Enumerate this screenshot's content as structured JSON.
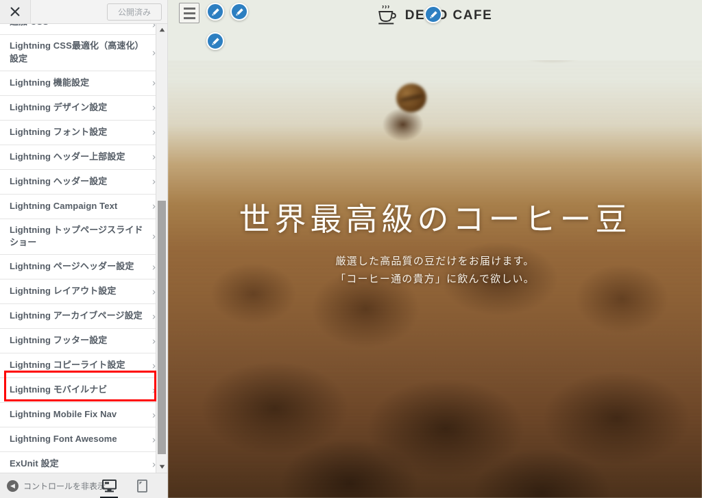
{
  "customizer": {
    "close_label": "×",
    "close_icon": "close-icon",
    "publish_label": "公開済み",
    "panels": [
      {
        "label": "追加 CSS",
        "cut": true
      },
      {
        "label": "Lightning CSS最適化（高速化）設定",
        "cut": false
      },
      {
        "label": "Lightning 機能設定",
        "cut": false
      },
      {
        "label": "Lightning デザイン設定",
        "cut": false
      },
      {
        "label": "Lightning フォント設定",
        "cut": false
      },
      {
        "label": "Lightning ヘッダー上部設定",
        "cut": false
      },
      {
        "label": "Lightning ヘッダー設定",
        "cut": false
      },
      {
        "label": "Lightning Campaign Text",
        "cut": false
      },
      {
        "label": "Lightning トップページスライドショー",
        "cut": false
      },
      {
        "label": "Lightning ページヘッダー設定",
        "cut": false
      },
      {
        "label": "Lightning レイアウト設定",
        "cut": false
      },
      {
        "label": "Lightning アーカイブページ設定",
        "cut": false
      },
      {
        "label": "Lightning フッター設定",
        "cut": false
      },
      {
        "label": "Lightning コピーライト設定",
        "cut": false
      },
      {
        "label": "Lightning モバイルナビ",
        "cut": false
      },
      {
        "label": "Lightning Mobile Fix Nav",
        "cut": false
      },
      {
        "label": "Lightning Font Awesome",
        "cut": false
      },
      {
        "label": "ExUnit 設定",
        "cut": false
      }
    ],
    "chevron": "›",
    "highlighted_panel": "Lightning コピーライト設定",
    "highlight_color": "#fe0000",
    "scrollbar": {
      "up_arrow": "▴",
      "down_arrow": "▾"
    },
    "footer": {
      "collapse_label": "コントロールを非表示",
      "collapse_icon": "chevron-left-icon",
      "devices": [
        {
          "name": "desktop",
          "active": true
        },
        {
          "name": "tablet",
          "active": false
        },
        {
          "name": "mobile",
          "active": false
        }
      ]
    }
  },
  "preview": {
    "menu_icon": "hamburger-menu-icon",
    "logo": {
      "icon": "coffee-cup-icon",
      "text": "DEMO CAFE"
    },
    "edit_pins": [
      {
        "name": "edit-pin-menu"
      },
      {
        "name": "edit-pin-header"
      },
      {
        "name": "edit-pin-campaign"
      },
      {
        "name": "edit-pin-logo"
      }
    ],
    "hero": {
      "title": "世界最高級のコーヒー豆",
      "subtitle_line1": "厳選した高品質の豆だけをお届けます。",
      "subtitle_line2": "「コーヒー通の貴方」に飲んで欲しい。"
    }
  },
  "colors": {
    "accent_blue": "#2d7fc1",
    "highlight_red": "#fe0000",
    "header_bg": "#e9ece4",
    "sidebar_bg": "#eeeeee",
    "label_text": "#555d66"
  }
}
